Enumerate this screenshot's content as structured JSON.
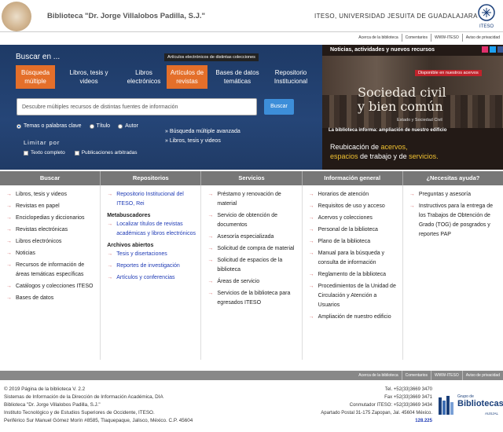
{
  "header": {
    "title": "Biblioteca \"Dr. Jorge Villalobos Padilla, S.J.\"",
    "university": "ITESO, UNIVERSIDAD JESUITA DE GUADALAJARA",
    "iteso_logo_text": "ITESO"
  },
  "top_links": [
    "Acerca de la biblioteca",
    "Comentarios",
    "WWW-ITESO",
    "Aviso de privacidad"
  ],
  "search": {
    "heading": "Buscar en ...",
    "tabs": [
      {
        "label1": "Búsqueda",
        "label2": "múltiple",
        "active": true
      },
      {
        "label1": "Libros, tesis y",
        "label2": "videos",
        "active": false
      },
      {
        "label1": "Libros",
        "label2": "electrónicos",
        "active": false
      },
      {
        "label1": "Artículos de",
        "label2": "revistas",
        "active": true
      },
      {
        "label1": "Bases de datos",
        "label2": "temáticas",
        "active": false
      },
      {
        "label1": "Repositorio",
        "label2": "Institucional",
        "active": false
      }
    ],
    "tooltip": "Artículos electrónicos de distintas colecciones",
    "placeholder": "Descubre múltiples recursos de distintas fuentes de información",
    "button": "Buscar",
    "radios": [
      {
        "label": "Temas o palabras clave",
        "checked": true
      },
      {
        "label": "Título",
        "checked": false
      },
      {
        "label": "Autor",
        "checked": false
      }
    ],
    "advanced_links": [
      "Búsqueda múltiple avanzada",
      "Libros, tesis y videos"
    ],
    "limit_heading": "Limitar por",
    "checks": [
      "Texto completo",
      "Publicaciones arbitradas"
    ]
  },
  "news": {
    "title": "Noticias, actividades y nuevos recursos",
    "badge": "Disponible en nuestros acervos",
    "headline1": "Sociedad civil",
    "headline2": "y bien común",
    "subline": "Estado y Sociedad Civil",
    "informa": "La biblioteca informa: ampliación de nuestro edificio",
    "reub_line1_a": "Reubicación de ",
    "reub_line1_b": "acervos,",
    "reub_line2_a": "espacios",
    "reub_line2_b": " de trabajo y de ",
    "reub_line2_c": "servicios."
  },
  "menubar": [
    "Buscar",
    "Repositorios",
    "Servicios",
    "Información general",
    "¿Necesitas ayuda?"
  ],
  "columns": {
    "buscar": [
      "Libros, tesis y videos",
      "Revistas en papel",
      "Enciclopedias y diccionarios",
      "Revistas electrónicas",
      "Libros electrónicos",
      "Noticias",
      "Recursos de información de áreas temáticas específicas",
      "Catálogos y colecciones ITESO",
      "Bases de datos"
    ],
    "repositorios": {
      "top": [
        "Repositorio Institucional del ITESO, Rei"
      ],
      "meta_head": "Metabuscadores",
      "meta": [
        "Localizar títulos de revistas académicas y libros electrónicos"
      ],
      "archivos_head": "Archivos abiertos",
      "archivos": [
        "Tesis y disertaciones",
        "Reportes de investigación",
        "Artículos y conferencias"
      ]
    },
    "servicios": [
      "Préstamo y renovación de material",
      "Servicio de obtención de documentos",
      "Asesoría especializada",
      "Solicitud de compra de material",
      "Solicitud de espacios de la biblioteca",
      "Áreas de servicio",
      "Servicios de la biblioteca para egresados ITESO"
    ],
    "informacion": [
      "Horarios de atención",
      "Requisitos de uso y acceso",
      "Acervos y colecciones",
      "Personal de la biblioteca",
      "Plano de la biblioteca",
      "Manual para la búsqueda y consulta de información",
      "Reglamento de la biblioteca",
      "Procedimientos de la Unidad de Circulación y Atención a Usuarios",
      "Ampliación de nuestro edificio"
    ],
    "ayuda": [
      "Preguntas y asesoría",
      "Instructivos para la entrega de los Trabajos de Obtención de Grado (TOG) de posgrados y reportes PAP"
    ]
  },
  "footer": {
    "links": [
      "Acerca de la biblioteca",
      "Comentarios",
      "WWW-ITESO",
      "Aviso de privacidad"
    ],
    "left": [
      "© 2019 Página de la biblioteca V. 2.2",
      "Sistemas de Información de la Dirección de Información Académica, DIA",
      "Biblioteca \"Dr. Jorge Villalobos Padilla, S.J.\"",
      "Instituto Tecnológico y de Estudios Superiores de Occidente, ITESO.",
      "Periférico Sur Manuel Gómez Morín #8585, Tlaquepaque, Jalisco, México. C.P. 45604"
    ],
    "right": [
      "Tel. +52(33)3669 3470",
      "Fax +52(33)3669 3471",
      "Conmutador ITESO: +52(33)3669 3434",
      "Apartado Postal 31-175 Zapopan, Jal. 45604 México."
    ],
    "visits": "128.225",
    "logo_small": "Grupo de",
    "logo_big": "Bibliotecas",
    "logo_tiny": "AUSJAL"
  }
}
